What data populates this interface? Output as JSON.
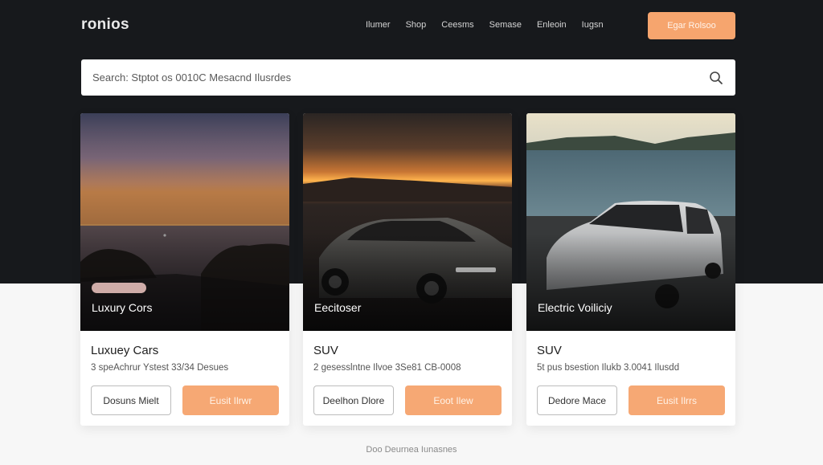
{
  "brand": {
    "logo": "ronios"
  },
  "nav": {
    "items": [
      "Ilumer",
      "Shop",
      "Ceesms",
      "Semase",
      "Enleoin",
      "Iugsn"
    ],
    "cta_label": "Egar Rolsoo"
  },
  "search": {
    "placeholder": "Search: Stptot os 0010C Mesacnd Ilusrdes"
  },
  "cards": [
    {
      "overlay_title": "Luxury Cors",
      "title": "Luxuey Cars",
      "description": "3 speAchrur Ystest 33/34 Desues",
      "secondary_label": "Dosuns Mielt",
      "primary_label": "Eusit Ilrwr"
    },
    {
      "overlay_title": "Eecitoser",
      "title": "SUV",
      "description": "2 gesesslntne Ilvoe 3Se81 CB-0008",
      "secondary_label": "Deelhon Dlore",
      "primary_label": "Eoot Ilew"
    },
    {
      "overlay_title": "Electric Voiliciy",
      "title": "SUV",
      "description": "5t pus bsestion Ilukb 3.0041 Ilusdd",
      "secondary_label": "Dedore Mace",
      "primary_label": "Eusit Ilrrs"
    }
  ],
  "footer": {
    "text": "Doo Deurnea Iunasnes"
  },
  "colors": {
    "accent": "#f6a56e",
    "dark_bg": "#17191c"
  }
}
